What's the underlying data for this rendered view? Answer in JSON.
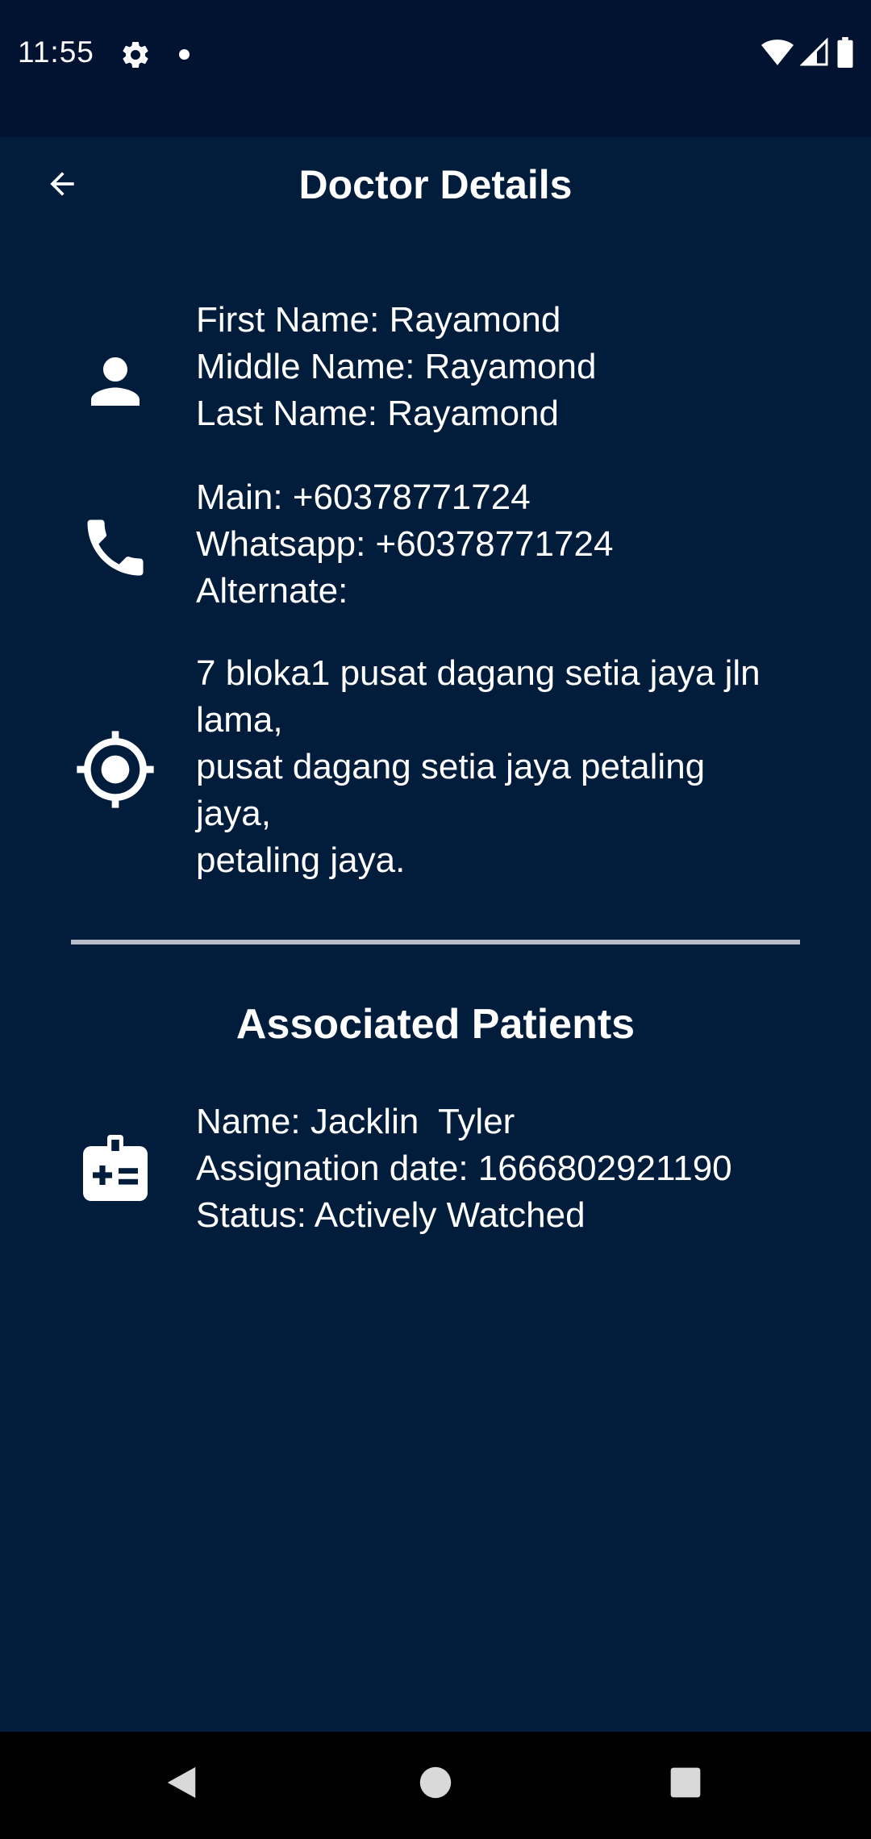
{
  "status_bar": {
    "time": "11:55",
    "icons": [
      "gear-icon",
      "notification-dot",
      "wifi-icon",
      "signal-icon",
      "battery-icon"
    ]
  },
  "app_bar": {
    "title": "Doctor Details",
    "back_icon": "arrow-left-icon"
  },
  "doctor": {
    "name": {
      "icon": "person-icon",
      "lines": [
        "First Name: Rayamond",
        "Middle Name: Rayamond",
        "Last Name: Rayamond"
      ]
    },
    "phone": {
      "icon": "phone-icon",
      "lines": [
        "Main: +60378771724",
        "Whatsapp: +60378771724",
        "Alternate:"
      ]
    },
    "address": {
      "icon": "location-target-icon",
      "lines": [
        "7 bloka1 pusat dagang setia jaya jln",
        "lama,",
        "pusat dagang setia jaya petaling",
        "jaya,",
        "petaling jaya."
      ]
    }
  },
  "associated_patients": {
    "title": "Associated Patients",
    "patients": [
      {
        "icon": "medical-badge-icon",
        "name": "Name: Jacklin  Tyler",
        "assignation_date": "Assignation date: 1666802921190",
        "status": "Status: Actively Watched"
      }
    ]
  },
  "colors": {
    "background": "#011d3b",
    "status_bar": "#011330",
    "text": "#ffffff",
    "divider": "#b8bec8",
    "nav_bar": "#000000"
  },
  "nav_bar": {
    "buttons": [
      "back-triangle-icon",
      "home-circle-icon",
      "recents-square-icon"
    ]
  }
}
